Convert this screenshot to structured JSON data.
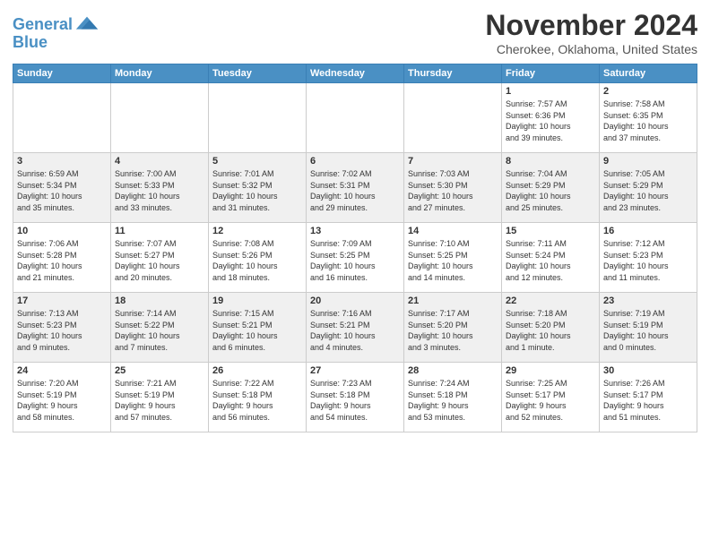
{
  "header": {
    "logo_general": "General",
    "logo_blue": "Blue",
    "month_title": "November 2024",
    "location": "Cherokee, Oklahoma, United States"
  },
  "calendar": {
    "days_of_week": [
      "Sunday",
      "Monday",
      "Tuesday",
      "Wednesday",
      "Thursday",
      "Friday",
      "Saturday"
    ],
    "weeks": [
      {
        "days": [
          {
            "num": "",
            "info": ""
          },
          {
            "num": "",
            "info": ""
          },
          {
            "num": "",
            "info": ""
          },
          {
            "num": "",
            "info": ""
          },
          {
            "num": "",
            "info": ""
          },
          {
            "num": "1",
            "info": "Sunrise: 7:57 AM\nSunset: 6:36 PM\nDaylight: 10 hours\nand 39 minutes."
          },
          {
            "num": "2",
            "info": "Sunrise: 7:58 AM\nSunset: 6:35 PM\nDaylight: 10 hours\nand 37 minutes."
          }
        ]
      },
      {
        "days": [
          {
            "num": "3",
            "info": "Sunrise: 6:59 AM\nSunset: 5:34 PM\nDaylight: 10 hours\nand 35 minutes."
          },
          {
            "num": "4",
            "info": "Sunrise: 7:00 AM\nSunset: 5:33 PM\nDaylight: 10 hours\nand 33 minutes."
          },
          {
            "num": "5",
            "info": "Sunrise: 7:01 AM\nSunset: 5:32 PM\nDaylight: 10 hours\nand 31 minutes."
          },
          {
            "num": "6",
            "info": "Sunrise: 7:02 AM\nSunset: 5:31 PM\nDaylight: 10 hours\nand 29 minutes."
          },
          {
            "num": "7",
            "info": "Sunrise: 7:03 AM\nSunset: 5:30 PM\nDaylight: 10 hours\nand 27 minutes."
          },
          {
            "num": "8",
            "info": "Sunrise: 7:04 AM\nSunset: 5:29 PM\nDaylight: 10 hours\nand 25 minutes."
          },
          {
            "num": "9",
            "info": "Sunrise: 7:05 AM\nSunset: 5:29 PM\nDaylight: 10 hours\nand 23 minutes."
          }
        ]
      },
      {
        "days": [
          {
            "num": "10",
            "info": "Sunrise: 7:06 AM\nSunset: 5:28 PM\nDaylight: 10 hours\nand 21 minutes."
          },
          {
            "num": "11",
            "info": "Sunrise: 7:07 AM\nSunset: 5:27 PM\nDaylight: 10 hours\nand 20 minutes."
          },
          {
            "num": "12",
            "info": "Sunrise: 7:08 AM\nSunset: 5:26 PM\nDaylight: 10 hours\nand 18 minutes."
          },
          {
            "num": "13",
            "info": "Sunrise: 7:09 AM\nSunset: 5:25 PM\nDaylight: 10 hours\nand 16 minutes."
          },
          {
            "num": "14",
            "info": "Sunrise: 7:10 AM\nSunset: 5:25 PM\nDaylight: 10 hours\nand 14 minutes."
          },
          {
            "num": "15",
            "info": "Sunrise: 7:11 AM\nSunset: 5:24 PM\nDaylight: 10 hours\nand 12 minutes."
          },
          {
            "num": "16",
            "info": "Sunrise: 7:12 AM\nSunset: 5:23 PM\nDaylight: 10 hours\nand 11 minutes."
          }
        ]
      },
      {
        "days": [
          {
            "num": "17",
            "info": "Sunrise: 7:13 AM\nSunset: 5:23 PM\nDaylight: 10 hours\nand 9 minutes."
          },
          {
            "num": "18",
            "info": "Sunrise: 7:14 AM\nSunset: 5:22 PM\nDaylight: 10 hours\nand 7 minutes."
          },
          {
            "num": "19",
            "info": "Sunrise: 7:15 AM\nSunset: 5:21 PM\nDaylight: 10 hours\nand 6 minutes."
          },
          {
            "num": "20",
            "info": "Sunrise: 7:16 AM\nSunset: 5:21 PM\nDaylight: 10 hours\nand 4 minutes."
          },
          {
            "num": "21",
            "info": "Sunrise: 7:17 AM\nSunset: 5:20 PM\nDaylight: 10 hours\nand 3 minutes."
          },
          {
            "num": "22",
            "info": "Sunrise: 7:18 AM\nSunset: 5:20 PM\nDaylight: 10 hours\nand 1 minute."
          },
          {
            "num": "23",
            "info": "Sunrise: 7:19 AM\nSunset: 5:19 PM\nDaylight: 10 hours\nand 0 minutes."
          }
        ]
      },
      {
        "days": [
          {
            "num": "24",
            "info": "Sunrise: 7:20 AM\nSunset: 5:19 PM\nDaylight: 9 hours\nand 58 minutes."
          },
          {
            "num": "25",
            "info": "Sunrise: 7:21 AM\nSunset: 5:19 PM\nDaylight: 9 hours\nand 57 minutes."
          },
          {
            "num": "26",
            "info": "Sunrise: 7:22 AM\nSunset: 5:18 PM\nDaylight: 9 hours\nand 56 minutes."
          },
          {
            "num": "27",
            "info": "Sunrise: 7:23 AM\nSunset: 5:18 PM\nDaylight: 9 hours\nand 54 minutes."
          },
          {
            "num": "28",
            "info": "Sunrise: 7:24 AM\nSunset: 5:18 PM\nDaylight: 9 hours\nand 53 minutes."
          },
          {
            "num": "29",
            "info": "Sunrise: 7:25 AM\nSunset: 5:17 PM\nDaylight: 9 hours\nand 52 minutes."
          },
          {
            "num": "30",
            "info": "Sunrise: 7:26 AM\nSunset: 5:17 PM\nDaylight: 9 hours\nand 51 minutes."
          }
        ]
      }
    ]
  }
}
